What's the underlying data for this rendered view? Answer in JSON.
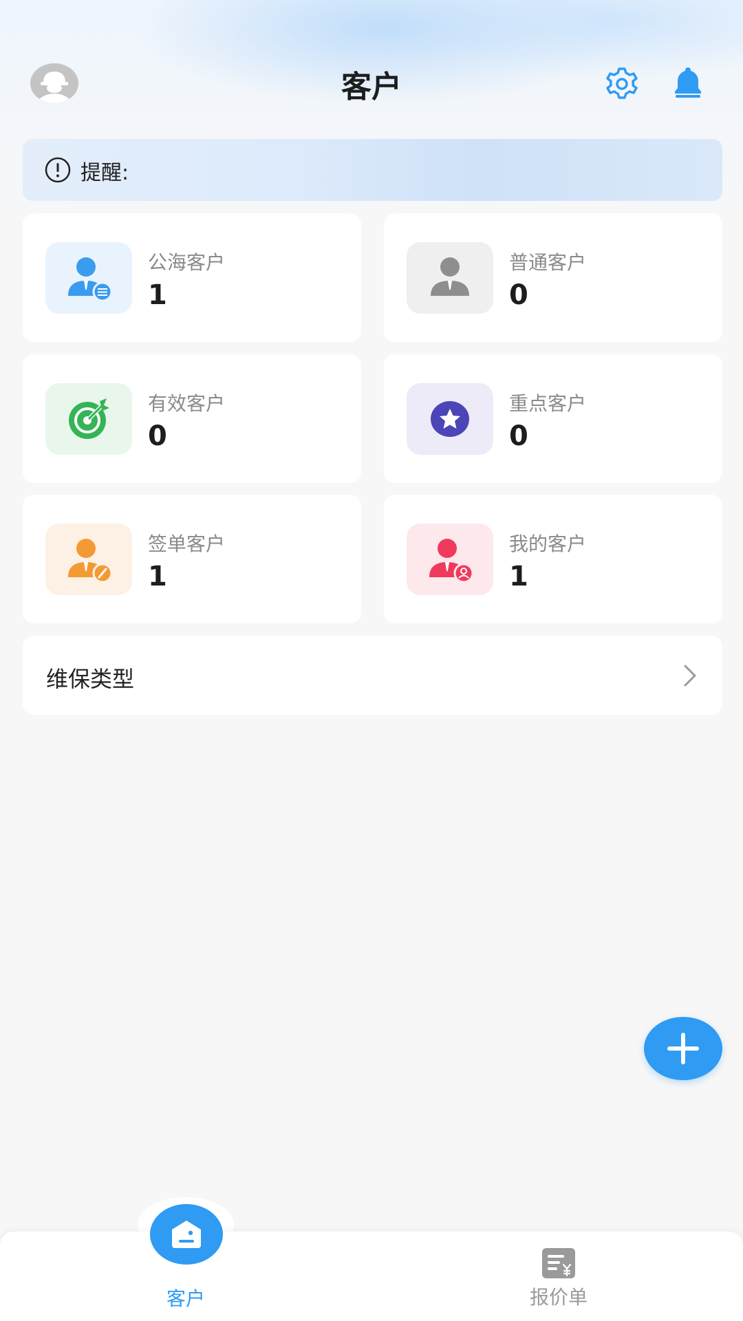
{
  "header": {
    "title": "客户",
    "avatar_icon": "worker-helmet-avatar-icon",
    "settings_icon": "gear-icon",
    "notifications_icon": "bell-icon"
  },
  "reminder": {
    "icon": "exclamation-circle-icon",
    "label": "提醒:"
  },
  "cards": [
    {
      "label": "公海客户",
      "count": "1",
      "icon": "user-list-icon",
      "color": "#3a9bef",
      "bg": "#e8f3fd"
    },
    {
      "label": "普通客户",
      "count": "0",
      "icon": "user-icon",
      "color": "#8e8e8e",
      "bg": "#efefef"
    },
    {
      "label": "有效客户",
      "count": "0",
      "icon": "target-icon",
      "color": "#35b455",
      "bg": "#e9f6ec"
    },
    {
      "label": "重点客户",
      "count": "0",
      "icon": "star-icon",
      "color": "#4c45b8",
      "bg": "#ecebf7"
    },
    {
      "label": "签单客户",
      "count": "1",
      "icon": "user-pen-icon",
      "color": "#f49a34",
      "bg": "#fdf1e6"
    },
    {
      "label": "我的客户",
      "count": "1",
      "icon": "user-self-icon",
      "color": "#ef3a5d",
      "bg": "#fde8ec"
    }
  ],
  "maintenance": {
    "label": "维保类型",
    "icon": "chevron-right-icon"
  },
  "fab": {
    "icon": "plus-icon"
  },
  "tabbar": {
    "tabs": [
      {
        "label": "客户",
        "icon": "customer-home-icon",
        "active": true
      },
      {
        "label": "报价单",
        "icon": "quote-document-icon",
        "active": false
      }
    ],
    "active_color": "#2f9bf2",
    "inactive_color": "#9a9a9a"
  }
}
